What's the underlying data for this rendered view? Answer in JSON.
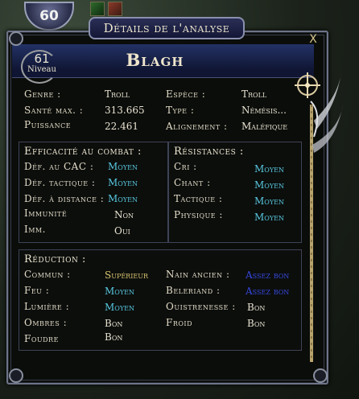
{
  "hud": {
    "player_level": "60"
  },
  "window": {
    "title": "Détails de l'analyse",
    "close_label": "X"
  },
  "target": {
    "name": "Blagh",
    "level": "61",
    "level_label": "Niveau"
  },
  "info": {
    "genre_label": "Genre :",
    "genre_value": "Troll",
    "espece_label": "Espèce :",
    "espece_value": "Troll",
    "sante_label": "Santé max. :",
    "sante_value": "313.665",
    "type_label": "Type :",
    "type_value": "Némésis...",
    "puissance_label": "Puissance",
    "puissance_value": "22.461",
    "alignement_label": "Alignement :",
    "alignement_value": "Maléfique"
  },
  "combat": {
    "title": "Efficacité au combat :",
    "rows": [
      {
        "label": "Déf. au CAC :",
        "value": "Moyen"
      },
      {
        "label": "Déf. tactique :",
        "value": "Moyen"
      },
      {
        "label": "Déf. à distance :",
        "value": "Moyen"
      },
      {
        "label": "Immunité",
        "value": "Non"
      },
      {
        "label": "Imm.",
        "value": "Oui"
      }
    ]
  },
  "resist": {
    "title": "Résistances :",
    "rows": [
      {
        "label": "Cri :",
        "value": "Moyen"
      },
      {
        "label": "Chant :",
        "value": "Moyen"
      },
      {
        "label": "Tactique :",
        "value": "Moyen"
      },
      {
        "label": "Physique :",
        "value": "Moyen"
      }
    ]
  },
  "reduction": {
    "title": "Réduction :",
    "left": [
      {
        "label": "Commun :",
        "value": "Supérieur"
      },
      {
        "label": "Feu :",
        "value": "Moyen"
      },
      {
        "label": "Lumière :",
        "value": "Moyen"
      },
      {
        "label": "Ombres :",
        "value": "Bon"
      },
      {
        "label": "Foudre",
        "value": "Bon"
      }
    ],
    "right": [
      {
        "label": "Nain ancien :",
        "value": "Assez bon"
      },
      {
        "label": "Beleriand :",
        "value": "Assez bon"
      },
      {
        "label": "Ouistrenesse :",
        "value": "Bon"
      },
      {
        "label": "Froid",
        "value": "Bon"
      }
    ]
  },
  "colors": {
    "cyan": "#57c8df",
    "blue": "#3648e0",
    "gold": "#d9c56f",
    "frame": "#6e7488"
  }
}
